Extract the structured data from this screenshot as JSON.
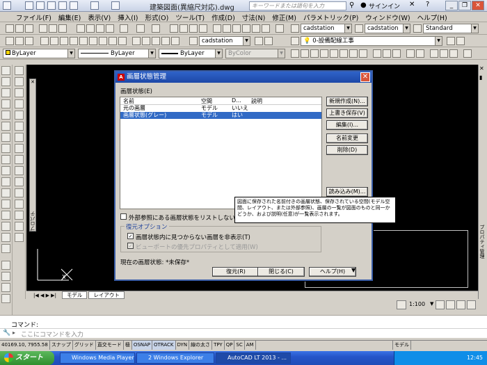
{
  "titlebar": {
    "document_title": "建築図面(異縮尺対応).dwg",
    "search_placeholder": "キーワードまたは語句を入力",
    "signin": "サインイン"
  },
  "menu": [
    "ファイル(F)",
    "編集(E)",
    "表示(V)",
    "挿入(I)",
    "形式(O)",
    "ツール(T)",
    "作成(D)",
    "寸法(N)",
    "修正(M)",
    "パラメトリック(P)",
    "ウィンドウ(W)",
    "ヘルプ(H)"
  ],
  "toolbar": {
    "text_style": "cadstation",
    "dim_style": "cadstation",
    "table_style": "Standard",
    "layer_text_style": "cadstation",
    "layer_name": "0-設備配線工事"
  },
  "properties_bar": {
    "color": "ByLayer",
    "linetype": "ByLayer",
    "lineweight": "ByLayer",
    "plotstyle": "ByColor"
  },
  "palette": {
    "properties_label": "プロパティ",
    "properties_manager_label": "プロパティ管理"
  },
  "dialog": {
    "title": "画層状態管理",
    "section_label": "画層状態(E)",
    "columns": [
      "名前",
      "空間",
      "D...",
      "説明"
    ],
    "rows": [
      {
        "name": "元の画層",
        "space": "モデル",
        "d": "いいえ",
        "desc": ""
      },
      {
        "name": "画層状態(グレー)",
        "space": "モデル",
        "d": "はい",
        "desc": ""
      }
    ],
    "buttons": {
      "new": "新規作成(N)...",
      "save": "上書き保存(V)",
      "edit": "編集(I)...",
      "rename": "名前変更",
      "delete": "削除(D)",
      "import": "読み込み(M)...",
      "restore": "復元(R)",
      "close": "閉じる(C)",
      "help": "ヘルプ(H)"
    },
    "xref_checkbox": "外部参照にある画層状態をリストしない(F)",
    "restore_options": "復元オプション",
    "hide_missing": "画層状態内に見つからない画層を非表示(T)",
    "viewport_override": "ビューポートの優先プロパティとして適用(W)",
    "current_state": "現在の画層状態: *未保存*",
    "tooltip": "図面に保存された名前付きの画層状態、保存されている空間(モデル空間、レイアウト、または外部参照)、画層の一覧が図面のものと同一かどうか、および説明(任意)が一覧表示されます。"
  },
  "tabs": [
    "モデル",
    "レイアウト"
  ],
  "right_controls": {
    "scale": "1:100"
  },
  "command": {
    "history": "コマンド:",
    "placeholder": "ここにコマンドを入力"
  },
  "status": {
    "coords": "40169.10, 7955.58",
    "toggles": [
      "スナップ",
      "グリッド",
      "直交モード",
      "極",
      "OSNAP",
      "OTRACK",
      "DYN",
      "線の太さ",
      "TPY",
      "QP",
      "SC",
      "AM"
    ],
    "model": "モデル"
  },
  "taskbar": {
    "start": "スタート",
    "tasks": [
      "Windows Media Player",
      "2 Windows Explorer",
      "AutoCAD LT 2013 - ..."
    ],
    "clock": "12:45"
  }
}
